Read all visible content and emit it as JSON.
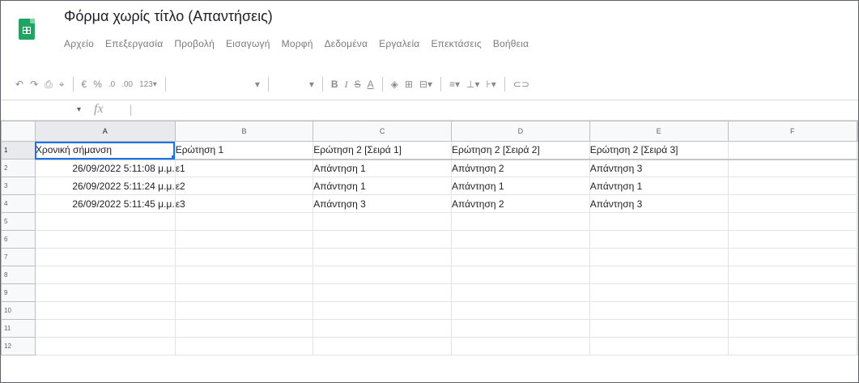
{
  "app": {
    "title": "Φόρμα χωρίς τίτλο (Απαντήσεις)"
  },
  "menu": [
    "Αρχείο",
    "Επεξεργασία",
    "Προβολή",
    "Εισαγωγή",
    "Μορφή",
    "Δεδομένα",
    "Εργαλεία",
    "Επεκτάσεις",
    "Βοήθεια"
  ],
  "toolbar": {
    "undo": "↶",
    "redo": "↷",
    "print": "⎙",
    "paint_format": "⌖",
    "currency": "€",
    "percent": "%",
    "decrease_decimals": ".0",
    "increase_decimals": ".00",
    "more_formats": "123",
    "font_dropdown": "▾",
    "size_dropdown": "▾",
    "bold": "B",
    "italic": "I",
    "strikethrough": "S",
    "text_color": "A",
    "fill_color": "◈",
    "borders": "⊞",
    "merge": "⊟",
    "h_align": "≡",
    "v_align": "⊥",
    "text_rotation": "⊦",
    "link": "⊂⊃"
  },
  "formula_bar": {
    "namebox_arrow": "▾",
    "fx": "fx",
    "value": ""
  },
  "columns": [
    "A",
    "B",
    "C",
    "D",
    "E",
    "F"
  ],
  "rows": [
    {
      "num": "1",
      "cells": [
        "Χρονική σήμανση",
        "Ερώτηση 1",
        "Ερώτηση 2 [Σειρά 1]",
        "Ερώτηση 2 [Σειρά 2]",
        "Ερώτηση 2 [Σειρά 3]",
        ""
      ]
    },
    {
      "num": "2",
      "cells": [
        "26/09/2022 5:11:08 μ.μ.",
        "ε1",
        "Απάντηση 1",
        "Απάντηση 2",
        "Απάντηση 3",
        ""
      ]
    },
    {
      "num": "3",
      "cells": [
        "26/09/2022 5:11:24 μ.μ.",
        "ε2",
        "Απάντηση 1",
        "Απάντηση 1",
        "Απάντηση 1",
        ""
      ]
    },
    {
      "num": "4",
      "cells": [
        "26/09/2022 5:11:45 μ.μ.",
        "ε3",
        "Απάντηση 3",
        "Απάντηση 2",
        "Απάντηση 3",
        ""
      ]
    },
    {
      "num": "5",
      "cells": [
        "",
        "",
        "",
        "",
        "",
        ""
      ]
    },
    {
      "num": "6",
      "cells": [
        "",
        "",
        "",
        "",
        "",
        ""
      ]
    },
    {
      "num": "7",
      "cells": [
        "",
        "",
        "",
        "",
        "",
        ""
      ]
    },
    {
      "num": "8",
      "cells": [
        "",
        "",
        "",
        "",
        "",
        ""
      ]
    },
    {
      "num": "9",
      "cells": [
        "",
        "",
        "",
        "",
        "",
        ""
      ]
    },
    {
      "num": "10",
      "cells": [
        "",
        "",
        "",
        "",
        "",
        ""
      ]
    },
    {
      "num": "11",
      "cells": [
        "",
        "",
        "",
        "",
        "",
        ""
      ]
    },
    {
      "num": "12",
      "cells": [
        "",
        "",
        "",
        "",
        "",
        ""
      ]
    }
  ]
}
